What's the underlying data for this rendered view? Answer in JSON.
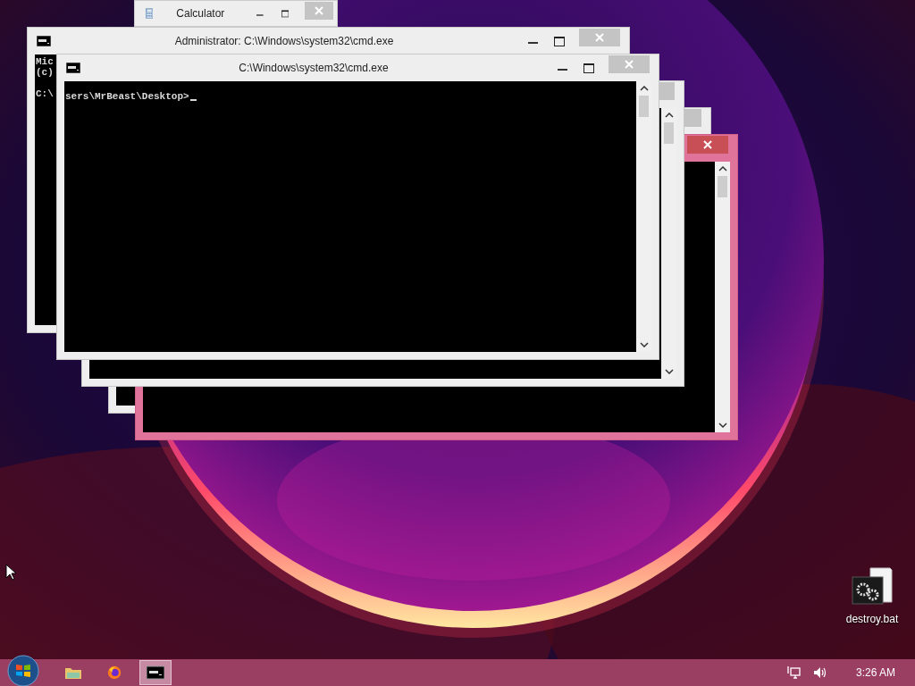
{
  "calculator": {
    "title": "Calculator"
  },
  "windows": [
    {
      "title": "Administrator: C:\\Windows\\system32\\cmd.exe",
      "active": false,
      "lines": [
        "Mic",
        "(c)",
        "C:\\"
      ]
    },
    {
      "title": "C:\\Windows\\system32\\cmd.exe",
      "active": false,
      "lines": [
        "sers\\MrBeast\\Desktop>"
      ],
      "cursor": true
    },
    {
      "active": false
    },
    {
      "active": false
    },
    {
      "active": true
    }
  ],
  "desktop_icons": [
    {
      "label": "destroy.bat"
    }
  ],
  "taskbar": {
    "apps": [
      {
        "kind": "folder",
        "selected": false
      },
      {
        "kind": "browser",
        "selected": false
      },
      {
        "kind": "console",
        "selected": true
      }
    ],
    "clock": "3:26 AM"
  }
}
